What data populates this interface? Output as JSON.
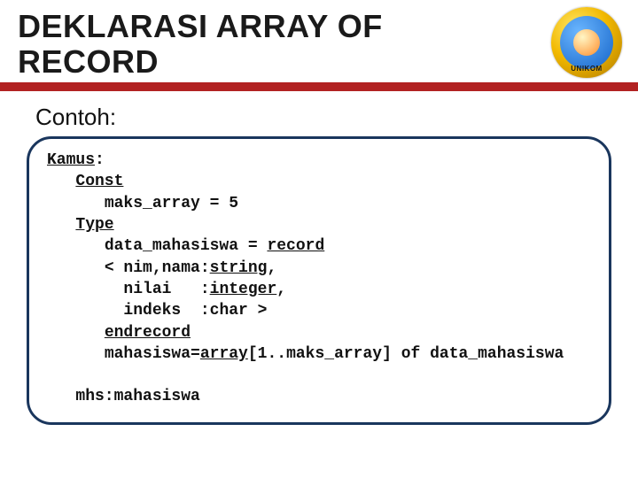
{
  "title": {
    "line1": "DEKLARASI ARRAY OF",
    "line2": "RECORD"
  },
  "logo": {
    "text": "UNIKOM"
  },
  "subtitle": "Contoh:",
  "code": {
    "kamus": "Kamus",
    "colon": ":",
    "const": "Const",
    "maks_line": "maks_array = 5",
    "type": "Type",
    "data_prefix": "data_mahasiswa = ",
    "record": "record",
    "nim_prefix": "< nim,nama:",
    "string": "string",
    "comma": ",",
    "nilai_prefix": "nilai   :",
    "integer": "integer",
    "indeks_line": "indeks  :char >",
    "endrecord": "endrecord",
    "mahasiswa_prefix": "mahasiswa=",
    "array": "array",
    "mahasiswa_suffix": "[1..maks_array] of data_mahasiswa",
    "mhs_line": "mhs:mahasiswa"
  }
}
